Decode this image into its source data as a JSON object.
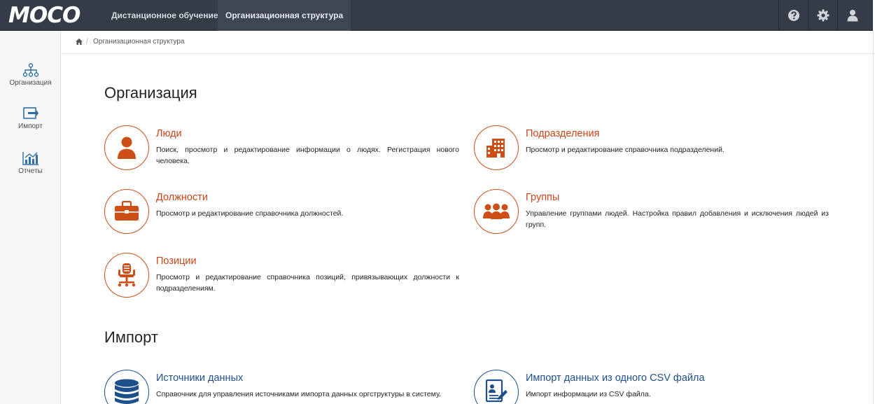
{
  "app": {
    "logo": "MOCO"
  },
  "nav": {
    "items": [
      {
        "label": "Дистанционное обучение"
      },
      {
        "label": "Организационная структура"
      }
    ]
  },
  "top_icons": [
    "help-icon",
    "settings-icon",
    "user-icon"
  ],
  "sidebar": {
    "items": [
      {
        "label": "Организация",
        "icon": "org-tree-icon"
      },
      {
        "label": "Импорт",
        "icon": "import-icon"
      },
      {
        "label": "Отчеты",
        "icon": "reports-icon"
      }
    ]
  },
  "breadcrumb": {
    "separator": "/",
    "current": "Организационная структура"
  },
  "sections": {
    "organization": {
      "title": "Организация",
      "cards": {
        "people": {
          "title": "Люди",
          "desc": "Поиск, просмотр и редактирование информации о людях. Регистрация нового человека.",
          "icon": "person-icon"
        },
        "departments": {
          "title": "Подразделения",
          "desc": "Просмотр и редактирование справочника подразделений.",
          "icon": "building-icon"
        },
        "posts": {
          "title": "Должности",
          "desc": "Просмотр и редактирование справочника должностей.",
          "icon": "briefcase-icon"
        },
        "groups": {
          "title": "Группы",
          "desc": "Управление группами людей. Настройка правил добавления и исключения людей из групп.",
          "icon": "group-icon"
        },
        "positions": {
          "title": "Позиции",
          "desc": "Просмотр и редактирование справочника позиций, привязывающих должности к подразделениям.",
          "icon": "office-chair-icon"
        }
      }
    },
    "import": {
      "title": "Импорт",
      "cards": {
        "sources": {
          "title": "Источники данных",
          "desc": "Справочник для управления источниками импорта данных оргструктуры в систему.",
          "icon": "database-icon"
        },
        "csv": {
          "title": "Импорт данных из одного CSV файла",
          "desc": "Импорт информации из CSV файла.",
          "icon": "csv-file-icon"
        }
      }
    }
  },
  "colors": {
    "topbar": "#353c48",
    "accent_orange": "#c6461a",
    "accent_blue": "#1e4f8a"
  }
}
